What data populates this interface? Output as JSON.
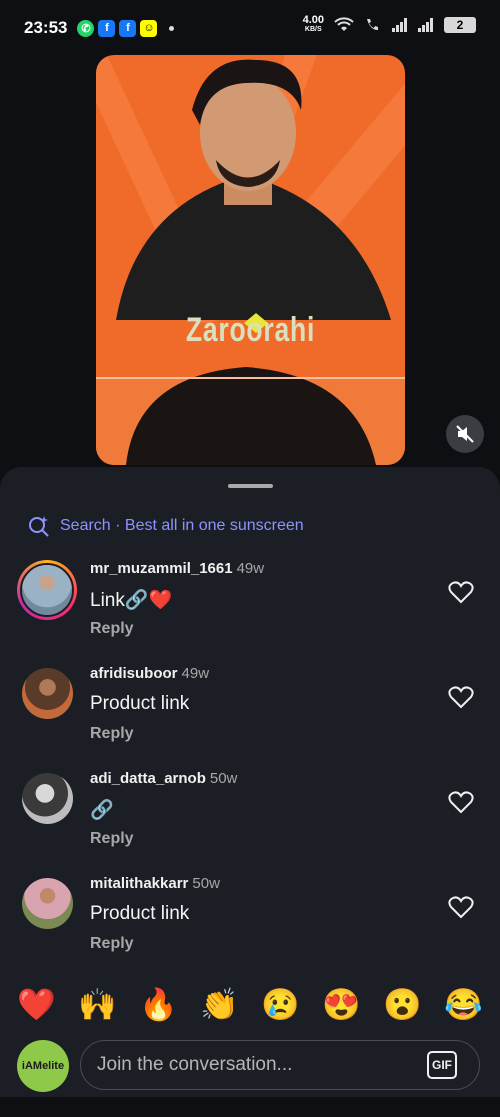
{
  "status_bar": {
    "time": "23:53",
    "net_speed": "4.00",
    "net_unit": "KB/S",
    "battery": "2",
    "notification_icons": [
      "whatsapp-icon",
      "facebook-icon",
      "facebook-icon",
      "snapchat-icon"
    ]
  },
  "video": {
    "caption": "Zaroorahi"
  },
  "search": {
    "prefix": "Search",
    "separator": " · ",
    "query": "Best all in one sunscreen"
  },
  "comments": [
    {
      "username": "mr_muzammil_1661",
      "time": "49w",
      "text": "Link🔗❤️",
      "reply_label": "Reply",
      "avatar_color": "#8aa0b4"
    },
    {
      "username": "afridisuboor",
      "time": "49w",
      "text": "Product link",
      "reply_label": "Reply",
      "avatar_color": "#6b3f2a"
    },
    {
      "username": "adi_datta_arnob",
      "time": "50w",
      "text": "🔗",
      "reply_label": "Reply",
      "avatar_color": "#9a9a9a"
    },
    {
      "username": "mitalithakkarr",
      "time": "50w",
      "text": "Product link",
      "reply_label": "Reply",
      "avatar_color": "#7f8a5e"
    }
  ],
  "emoji_bar": [
    "❤️",
    "🙌",
    "🔥",
    "👏",
    "😢",
    "😍",
    "😮",
    "😂"
  ],
  "composer": {
    "avatar_label": "iAMelite",
    "placeholder": "Join the conversation...",
    "gif_label": "GIF"
  },
  "colors": {
    "accent": "#8c93ff",
    "sheet_bg": "#1b1f25",
    "video_bg": "#f06a2a"
  }
}
